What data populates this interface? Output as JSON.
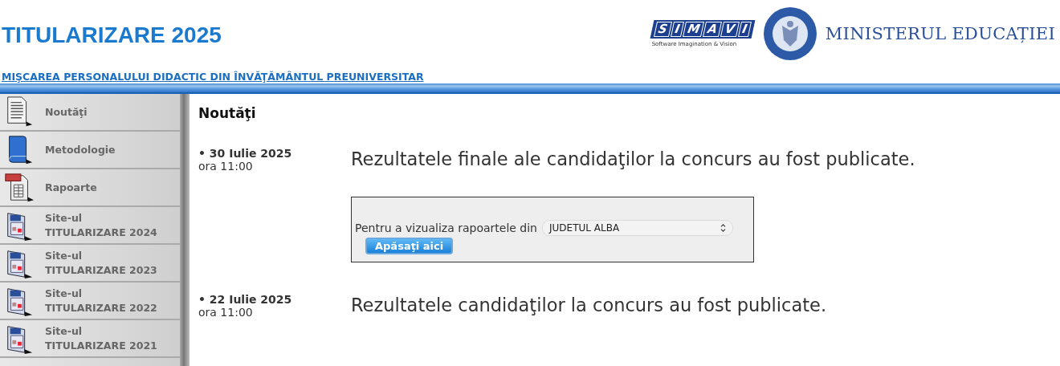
{
  "header": {
    "title": "TITULARIZARE 2025",
    "simavi_letters": [
      "S",
      "I",
      "M",
      "A",
      "V",
      "I"
    ],
    "simavi_tagline": "Software Imagination & Vision",
    "ministry": "MINISTERUL EDUCAȚIEI",
    "subtitle": "MIŞCAREA PERSONALULUI DIDACTIC DIN ÎNVĂŢĂMÂNTUL PREUNIVERSITAR"
  },
  "sidebar": {
    "items": [
      {
        "kind": "news",
        "label": "Noutăţi"
      },
      {
        "kind": "book",
        "label": "Metodologie"
      },
      {
        "kind": "report",
        "label": "Rapoarte"
      },
      {
        "kind": "site",
        "label": "Site-ul TITULARIZARE 2024"
      },
      {
        "kind": "site",
        "label": "Site-ul TITULARIZARE 2023"
      },
      {
        "kind": "site",
        "label": "Site-ul TITULARIZARE 2022"
      },
      {
        "kind": "site",
        "label": "Site-ul TITULARIZARE 2021"
      }
    ]
  },
  "content": {
    "heading": "Noutăţi",
    "news": [
      {
        "bullet": "•",
        "date": "30 Iulie 2025",
        "time": "ora 11:00",
        "headline": "Rezultatele finale ale candidaţilor la concurs au fost publicate.",
        "form": {
          "label": "Pentru a vizualiza rapoartele din",
          "select_value": "JUDETUL ALBA",
          "button": "Apăsaţi aici"
        }
      },
      {
        "bullet": "•",
        "date": "22 Iulie 2025",
        "time": "ora 11:00",
        "headline": "Rezultatele candidaţilor la concurs au fost publicate."
      }
    ]
  }
}
